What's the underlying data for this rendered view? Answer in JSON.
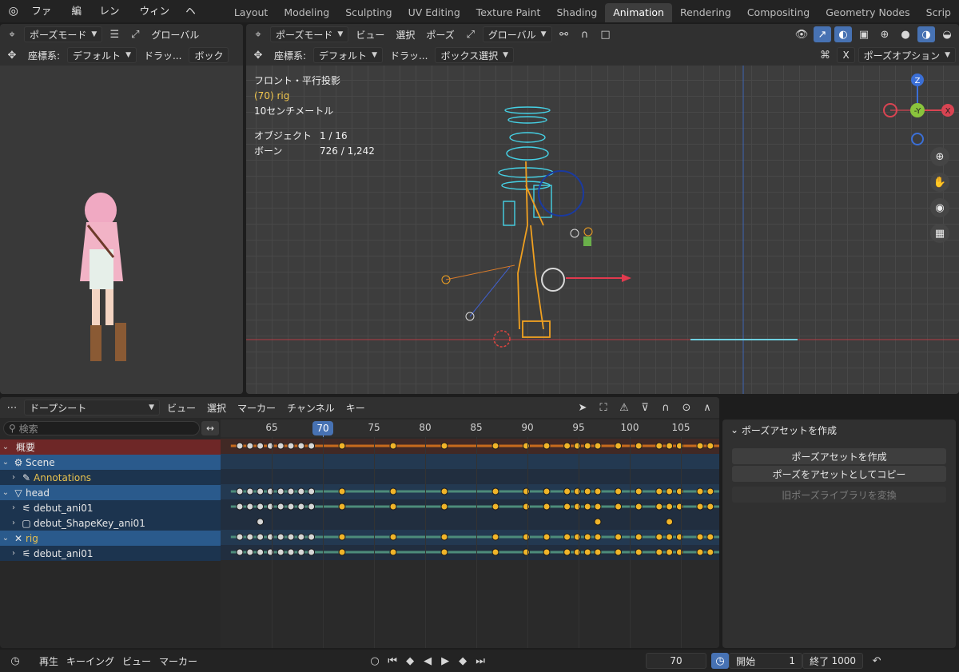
{
  "menu": [
    "ファイル",
    "編集",
    "レンダー",
    "ウィンドウ",
    "ヘルプ"
  ],
  "workspaces": [
    "Layout",
    "Modeling",
    "Sculpting",
    "UV Editing",
    "Texture Paint",
    "Shading",
    "Animation",
    "Rendering",
    "Compositing",
    "Geometry Nodes",
    "Scrip"
  ],
  "active_workspace": "Animation",
  "left_viewport": {
    "mode": "ポーズモード",
    "orientation": "グローバル",
    "coord_label": "座標系:",
    "coord_value": "デフォルト",
    "drag_label": "ドラッ...",
    "box_label": "ボック"
  },
  "main_viewport": {
    "mode": "ポーズモード",
    "menus": [
      "ビュー",
      "選択",
      "ポーズ"
    ],
    "orientation": "グローバル",
    "coord_label": "座標系:",
    "coord_value": "デフォルト",
    "drag_label": "ドラッ...",
    "box_select": "ボックス選択",
    "x_label": "X",
    "pose_options": "ポーズオプション",
    "view_name": "フロント・平行投影",
    "active_object": "(70) rig",
    "scale": "10センチメートル",
    "objects_label": "オブジェクト",
    "objects_value": "1 / 16",
    "bones_label": "ボーン",
    "bones_value": "726 / 1,242",
    "gizmo_z": "Z",
    "gizmo_y": "-Y",
    "gizmo_x": "X"
  },
  "dopesheet": {
    "editor": "ドープシート",
    "menus": [
      "ビュー",
      "選択",
      "マーカー",
      "チャンネル",
      "キー"
    ],
    "search_placeholder": "検索",
    "ruler_ticks": [
      65,
      70,
      75,
      80,
      85,
      90,
      95,
      100,
      105
    ],
    "current_frame": "70",
    "channels": [
      {
        "label": "概要",
        "type": "summary"
      },
      {
        "label": "Scene",
        "type": "scene"
      },
      {
        "label": "Annotations",
        "type": "child-gold"
      },
      {
        "label": "head",
        "type": "obj"
      },
      {
        "label": "debut_ani01",
        "type": "child"
      },
      {
        "label": "debut_ShapeKey_ani01",
        "type": "child"
      },
      {
        "label": "rig",
        "type": "obj-gold"
      },
      {
        "label": "debut_ani01",
        "type": "child"
      }
    ]
  },
  "pose_asset_panel": {
    "title": "ポーズアセットを作成",
    "create_button": "ポーズアセットを作成",
    "copy_button": "ポーズをアセットとしてコピー",
    "convert_button": "旧ポーズライブラリを変換"
  },
  "timeline_bar": {
    "playback": "再生",
    "keying": "キーイング",
    "view": "ビュー",
    "marker": "マーカー",
    "frame": "70",
    "start_label": "開始",
    "start_value": "1",
    "end_label": "終了",
    "end_value": "1000"
  }
}
